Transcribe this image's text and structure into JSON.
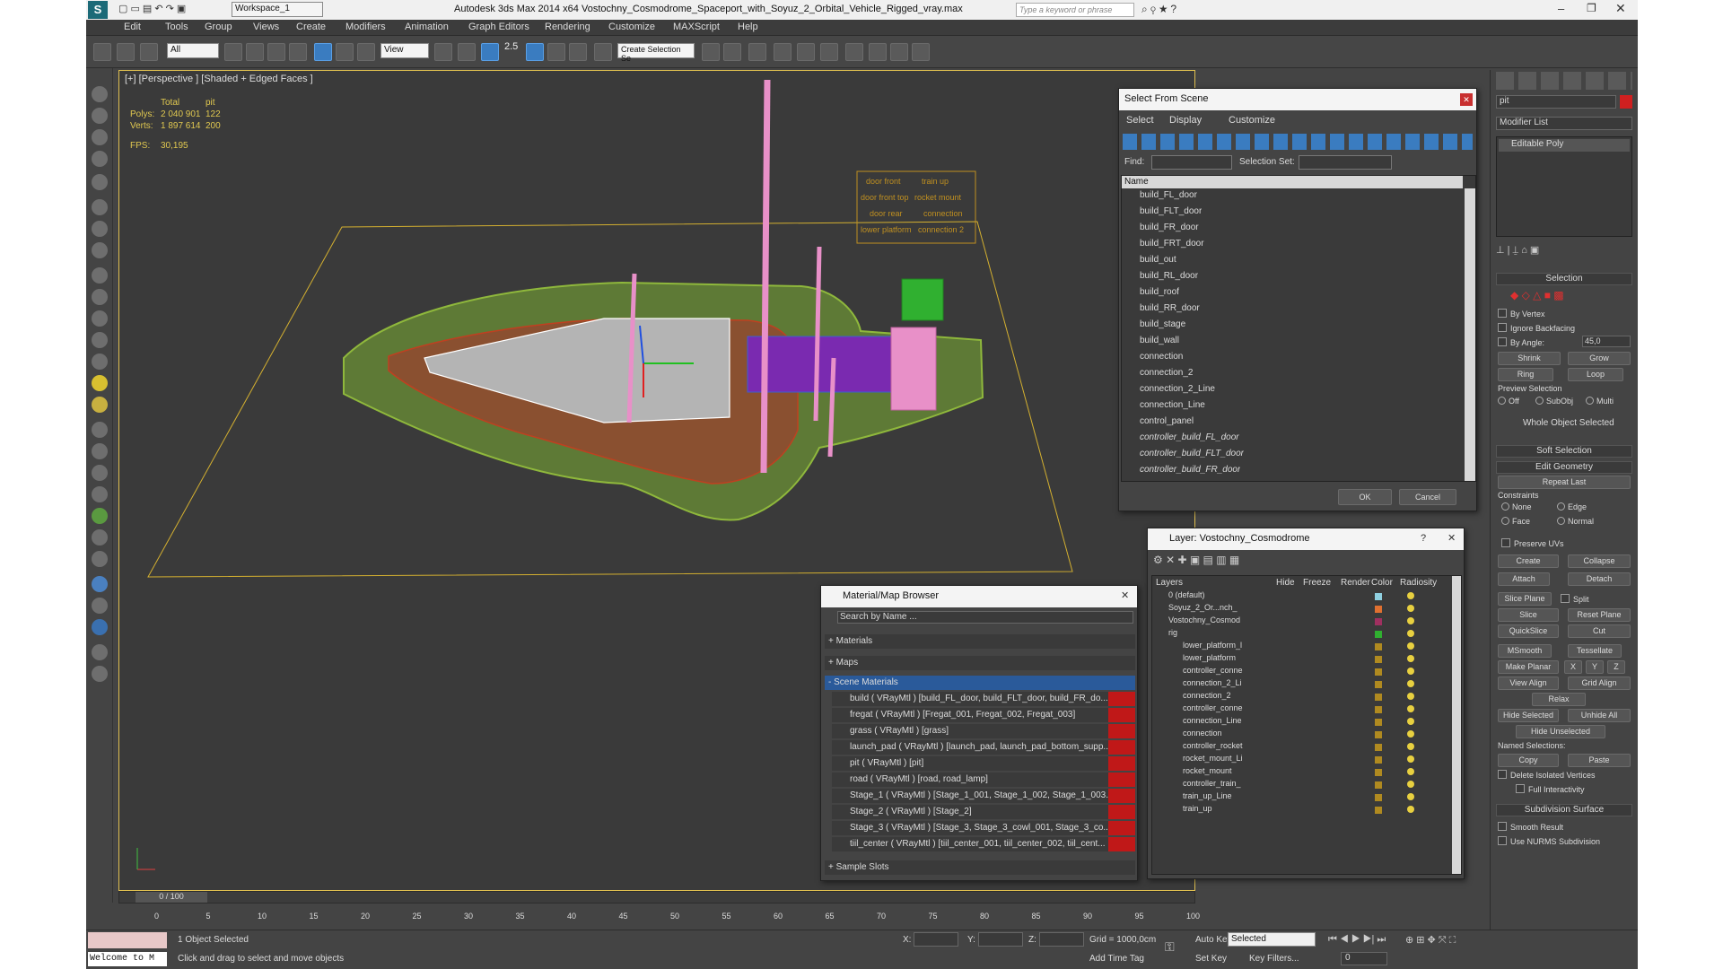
{
  "app": {
    "title": "Autodesk 3ds Max  2014 x64",
    "file": "Vostochny_Cosmodrome_Spaceport_with_Soyuz_2_Orbital_Vehicle_Rigged_vray.max",
    "workspace": "Workspace_1",
    "search_placeholder": "Type a keyword or phrase"
  },
  "menu": [
    "Edit",
    "Tools",
    "Group",
    "Views",
    "Create",
    "Modifiers",
    "Animation",
    "Graph Editors",
    "Rendering",
    "Customize",
    "MAXScript",
    "Help"
  ],
  "toolbar": {
    "filter": "All",
    "refcoord": "View",
    "selset": "Create Selection Se",
    "snap": "2.5"
  },
  "viewport": {
    "label": "[+] [Perspective ] [Shaded + Edged Faces ]",
    "stats": {
      "h1": "Total",
      "h2": "pit",
      "polys_label": "Polys:",
      "polys_total": "2 040 901",
      "polys_sel": "122",
      "verts_label": "Verts:",
      "verts_total": "1 897 614",
      "verts_sel": "200",
      "fps_label": "FPS:",
      "fps": "30,195"
    },
    "rig_labels": [
      "door front",
      "train up",
      "door front top",
      "rocket mount",
      "door rear",
      "connection",
      "lower platform",
      "connection 2"
    ]
  },
  "select_scene": {
    "title": "Select From Scene",
    "menu": [
      "Select",
      "Display",
      "Customize"
    ],
    "find_label": "Find:",
    "selset_label": "Selection Set:",
    "col_name": "Name",
    "items": [
      "build_FL_door",
      "build_FLT_door",
      "build_FR_door",
      "build_FRT_door",
      "build_out",
      "build_RL_door",
      "build_roof",
      "build_RR_door",
      "build_stage",
      "build_wall",
      "connection",
      "connection_2",
      "connection_2_Line",
      "connection_Line",
      "control_panel",
      "controller_build_FL_door",
      "controller_build_FLT_door",
      "controller_build_FR_door"
    ],
    "ok": "OK",
    "cancel": "Cancel"
  },
  "layer": {
    "title": "Layer: Vostochny_Cosmodrome",
    "cols": [
      "Layers",
      "Hide",
      "Freeze",
      "Render",
      "Color",
      "Radiosity"
    ],
    "items": [
      {
        "name": "0 (default)",
        "color": "#8fd0e0"
      },
      {
        "name": "Soyuz_2_Or...nch_",
        "color": "#e07030"
      },
      {
        "name": "Vostochny_Cosmod",
        "color": "#a03060"
      },
      {
        "name": "rig",
        "color": "#30b030"
      },
      {
        "name": "lower_platform_l",
        "color": "#b08a20"
      },
      {
        "name": "lower_platform",
        "color": "#b08a20"
      },
      {
        "name": "controller_conne",
        "color": "#b08a20"
      },
      {
        "name": "connection_2_Li",
        "color": "#b08a20"
      },
      {
        "name": "connection_2",
        "color": "#b08a20"
      },
      {
        "name": "controller_conne",
        "color": "#b08a20"
      },
      {
        "name": "connection_Line",
        "color": "#b08a20"
      },
      {
        "name": "connection",
        "color": "#b08a20"
      },
      {
        "name": "controller_rocket",
        "color": "#b08a20"
      },
      {
        "name": "rocket_mount_Li",
        "color": "#b08a20"
      },
      {
        "name": "rocket_mount",
        "color": "#b08a20"
      },
      {
        "name": "controller_train_",
        "color": "#b08a20"
      },
      {
        "name": "train_up_Line",
        "color": "#b08a20"
      },
      {
        "name": "train_up",
        "color": "#b08a20"
      }
    ]
  },
  "matbrowser": {
    "title": "Material/Map Browser",
    "search": "Search by Name ...",
    "sections": [
      "+ Materials",
      "+ Maps",
      "- Scene Materials"
    ],
    "sample": "+ Sample Slots",
    "materials": [
      "build  ( VRayMtl ) [build_FL_door, build_FLT_door, build_FR_do...",
      "fregat  ( VRayMtl ) [Fregat_001, Fregat_002, Fregat_003]",
      "grass  ( VRayMtl ) [grass]",
      "launch_pad  ( VRayMtl ) [launch_pad, launch_pad_bottom_supp...",
      "pit  ( VRayMtl ) [pit]",
      "road  ( VRayMtl ) [road, road_lamp]",
      "Stage_1  ( VRayMtl ) [Stage_1_001, Stage_1_002, Stage_1_003...",
      "Stage_2  ( VRayMtl ) [Stage_2]",
      "Stage_3  ( VRayMtl ) [Stage_3, Stage_3_cowl_001, Stage_3_co...",
      "tiil_center  ( VRayMtl ) [tiil_center_001, tiil_center_002, tiil_cent..."
    ]
  },
  "cmd": {
    "objname": "pit",
    "modlist": "Modifier List",
    "stack_item": "Editable Poly",
    "selection": "Selection",
    "by_vertex": "By Vertex",
    "ignore_bf": "Ignore Backfacing",
    "by_angle": "By Angle:",
    "angle": "45,0",
    "shrink": "Shrink",
    "grow": "Grow",
    "ring": "Ring",
    "loop": "Loop",
    "preview": "Preview Selection",
    "off": "Off",
    "subobj": "SubObj",
    "multi": "Multi",
    "whole": "Whole Object Selected",
    "soft": "Soft Selection",
    "edit_geo": "Edit Geometry",
    "repeat": "Repeat Last",
    "constraints": "Constraints",
    "none": "None",
    "edge": "Edge",
    "face": "Face",
    "normal": "Normal",
    "preserve": "Preserve UVs",
    "create": "Create",
    "collapse": "Collapse",
    "attach": "Attach",
    "detach": "Detach",
    "slice_plane": "Slice Plane",
    "split": "Split",
    "slice": "Slice",
    "reset_plane": "Reset Plane",
    "quickslice": "QuickSlice",
    "cut": "Cut",
    "msmooth": "MSmooth",
    "tessellate": "Tessellate",
    "make_planar": "Make Planar",
    "x": "X",
    "y": "Y",
    "z": "Z",
    "view_align": "View Align",
    "grid_align": "Grid Align",
    "relax": "Relax",
    "hide_sel": "Hide Selected",
    "unhide_all": "Unhide All",
    "hide_unsel": "Hide Unselected",
    "named_sel": "Named Selections:",
    "copy": "Copy",
    "paste": "Paste",
    "delete_iso": "Delete Isolated Vertices",
    "full_inter": "Full Interactivity",
    "subdiv": "Subdivision Surface",
    "smooth_res": "Smooth Result",
    "use_nurms": "Use NURMS Subdivision"
  },
  "timeline": {
    "frame": "0 / 100",
    "ticks": [
      "0",
      "5",
      "10",
      "15",
      "20",
      "25",
      "30",
      "35",
      "40",
      "45",
      "50",
      "55",
      "60",
      "65",
      "70",
      "75",
      "80",
      "85",
      "90",
      "95",
      "100"
    ]
  },
  "status": {
    "selected": "1 Object Selected",
    "prompt": "Click and drag to select and move objects",
    "welcome": "Welcome to M",
    "x": "X:",
    "y": "Y:",
    "z": "Z:",
    "grid": "Grid = 1000,0cm",
    "add_tag": "Add Time Tag",
    "autokey": "Auto Key",
    "setkey": "Set Key",
    "selmode": "Selected",
    "keyfilters": "Key Filters...",
    "frame_field": "0"
  }
}
